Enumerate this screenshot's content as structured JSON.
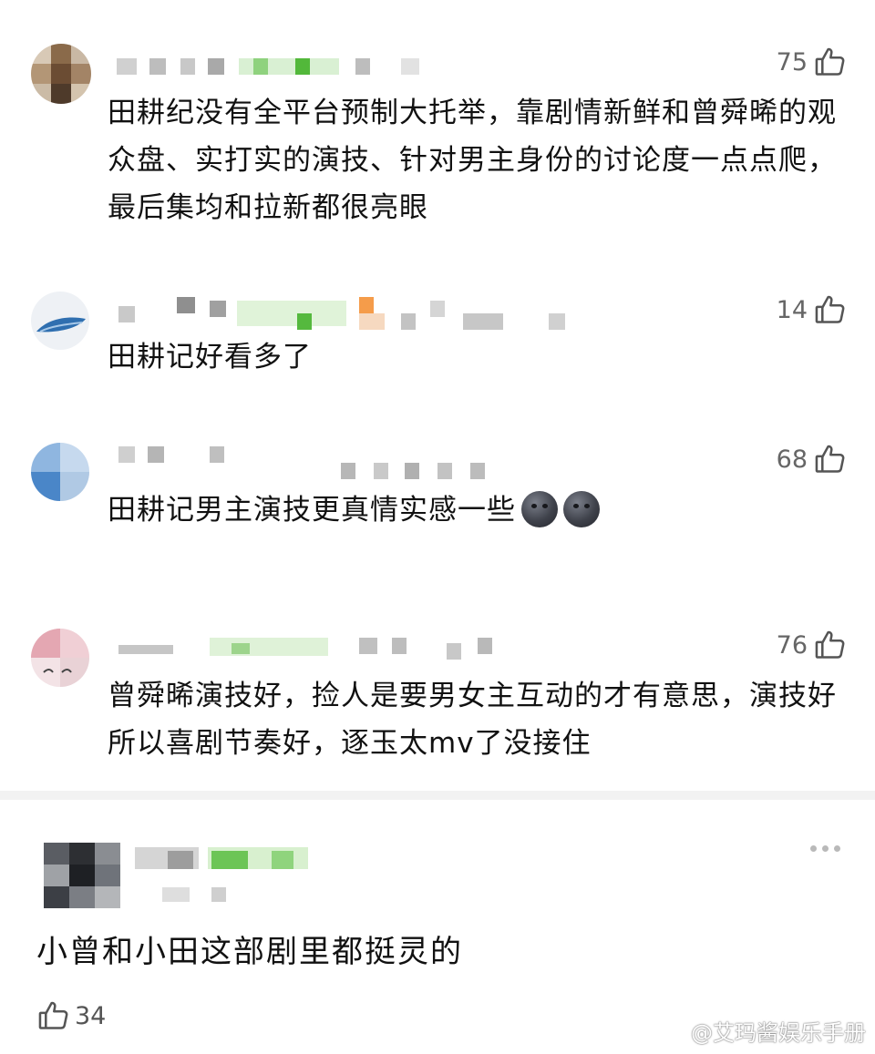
{
  "comments": [
    {
      "likes": "75",
      "text": "田耕纪没有全平台预制大托举，靠剧情新鲜和曾舜晞的观众盘、实打实的演技、针对男主身份的讨论度一点点爬，最后集均和拉新都很亮眼"
    },
    {
      "likes": "14",
      "text": "田耕记好看多了"
    },
    {
      "likes": "68",
      "text": "田耕记男主演技更真情实感一些"
    },
    {
      "likes": "76",
      "text": "曾舜晞演技好，捡人是要男女主互动的才有意思，演技好所以喜剧节奏好，逐玉太mv了没接住"
    }
  ],
  "featured": {
    "text": "小曾和小田这部剧里都挺灵的",
    "likes": "34"
  },
  "watermark": "@艾玛酱娱乐手册",
  "icons": {
    "like": "thumbs-up-icon",
    "more": "more-icon",
    "emoji": "new-moon-face-emoji",
    "weibo": "weibo-logo-icon"
  }
}
